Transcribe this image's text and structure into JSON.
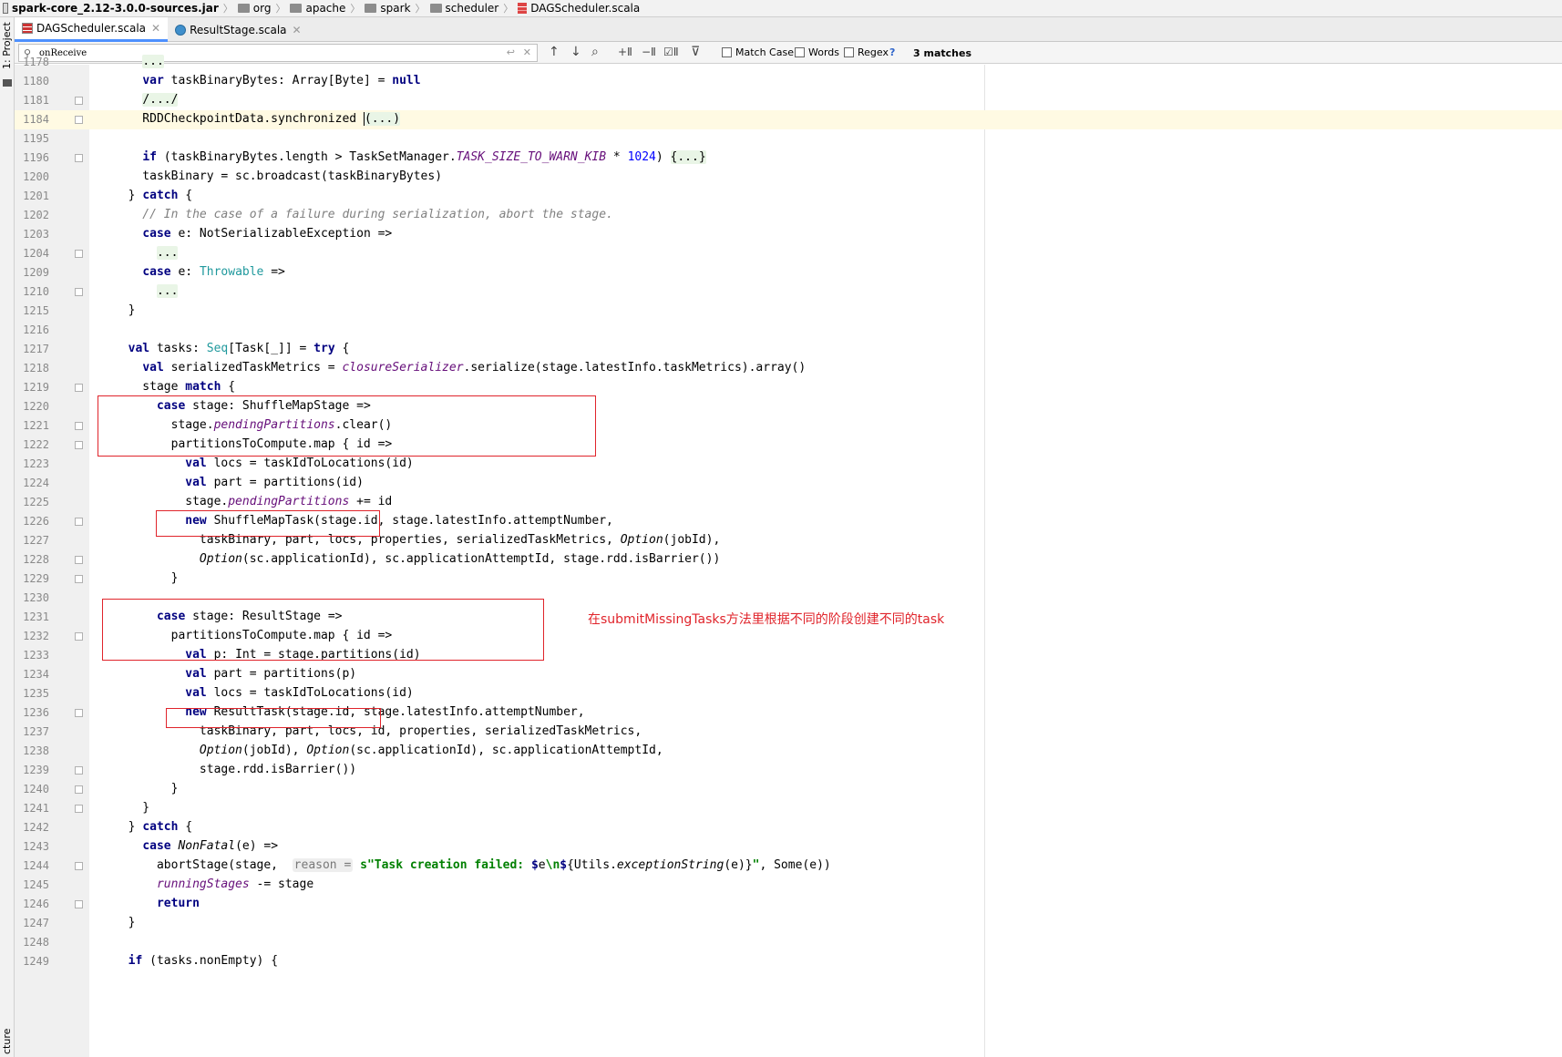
{
  "breadcrumb": [
    {
      "label": "spark-core_2.12-3.0.0-sources.jar",
      "icon": "jar-icon"
    },
    {
      "label": "org",
      "icon": "folder-icon"
    },
    {
      "label": "apache",
      "icon": "folder-icon"
    },
    {
      "label": "spark",
      "icon": "folder-icon"
    },
    {
      "label": "scheduler",
      "icon": "folder-icon"
    },
    {
      "label": "DAGScheduler.scala",
      "icon": "scala-file-icon"
    }
  ],
  "left_strip": {
    "project": "1: Project",
    "structure": "cture"
  },
  "tabs": [
    {
      "label": "DAGScheduler.scala",
      "active": true
    },
    {
      "label": "ResultStage.scala",
      "active": false
    }
  ],
  "search": {
    "query": "onReceive",
    "match_case": "Match Case",
    "words": "Words",
    "regex": "Regex",
    "help": "?",
    "matches": "3 matches"
  },
  "annotation": "在submitMissingTasks方法里根据不同的阶段创建不同的task",
  "lines": [
    {
      "n": "1178",
      "code": "    ..."
    },
    {
      "n": "1180",
      "code": "    var taskBinaryBytes: Array[Byte] = null"
    },
    {
      "n": "1181",
      "code": "    /.../"
    },
    {
      "n": "1184",
      "code": "    RDDCheckpointData.synchronized (...)"
    },
    {
      "n": "1195",
      "code": ""
    },
    {
      "n": "1196",
      "code": "    if (taskBinaryBytes.length > TaskSetManager.TASK_SIZE_TO_WARN_KIB * 1024) {...}"
    },
    {
      "n": "1200",
      "code": "    taskBinary = sc.broadcast(taskBinaryBytes)"
    },
    {
      "n": "1201",
      "code": "  } catch {"
    },
    {
      "n": "1202",
      "code": "    // In the case of a failure during serialization, abort the stage."
    },
    {
      "n": "1203",
      "code": "    case e: NotSerializableException =>"
    },
    {
      "n": "1204",
      "code": "      ..."
    },
    {
      "n": "1209",
      "code": "    case e: Throwable =>"
    },
    {
      "n": "1210",
      "code": "      ..."
    },
    {
      "n": "1215",
      "code": "  }"
    },
    {
      "n": "1216",
      "code": ""
    },
    {
      "n": "1217",
      "code": "  val tasks: Seq[Task[_]] = try {"
    },
    {
      "n": "1218",
      "code": "    val serializedTaskMetrics = closureSerializer.serialize(stage.latestInfo.taskMetrics).array()"
    },
    {
      "n": "1219",
      "code": "    stage match {"
    },
    {
      "n": "1220",
      "code": "      case stage: ShuffleMapStage =>"
    },
    {
      "n": "1221",
      "code": "        stage.pendingPartitions.clear()"
    },
    {
      "n": "1222",
      "code": "        partitionsToCompute.map { id =>"
    },
    {
      "n": "1223",
      "code": "          val locs = taskIdToLocations(id)"
    },
    {
      "n": "1224",
      "code": "          val part = partitions(id)"
    },
    {
      "n": "1225",
      "code": "          stage.pendingPartitions += id"
    },
    {
      "n": "1226",
      "code": "          new ShuffleMapTask(stage.id, stage.latestInfo.attemptNumber,"
    },
    {
      "n": "1227",
      "code": "            taskBinary, part, locs, properties, serializedTaskMetrics, Option(jobId),"
    },
    {
      "n": "1228",
      "code": "            Option(sc.applicationId), sc.applicationAttemptId, stage.rdd.isBarrier())"
    },
    {
      "n": "1229",
      "code": "        }"
    },
    {
      "n": "1230",
      "code": ""
    },
    {
      "n": "1231",
      "code": "      case stage: ResultStage =>"
    },
    {
      "n": "1232",
      "code": "        partitionsToCompute.map { id =>"
    },
    {
      "n": "1233",
      "code": "          val p: Int = stage.partitions(id)"
    },
    {
      "n": "1234",
      "code": "          val part = partitions(p)"
    },
    {
      "n": "1235",
      "code": "          val locs = taskIdToLocations(id)"
    },
    {
      "n": "1236",
      "code": "          new ResultTask(stage.id, stage.latestInfo.attemptNumber,"
    },
    {
      "n": "1237",
      "code": "            taskBinary, part, locs, id, properties, serializedTaskMetrics,"
    },
    {
      "n": "1238",
      "code": "            Option(jobId), Option(sc.applicationId), sc.applicationAttemptId,"
    },
    {
      "n": "1239",
      "code": "            stage.rdd.isBarrier())"
    },
    {
      "n": "1240",
      "code": "        }"
    },
    {
      "n": "1241",
      "code": "    }"
    },
    {
      "n": "1242",
      "code": "  } catch {"
    },
    {
      "n": "1243",
      "code": "    case NonFatal(e) =>"
    },
    {
      "n": "1244",
      "code": "      abortStage(stage,  reason = s\"Task creation failed: $e\\n${Utils.exceptionString(e)}\", Some(e))"
    },
    {
      "n": "1245",
      "code": "      runningStages -= stage"
    },
    {
      "n": "1246",
      "code": "      return"
    },
    {
      "n": "1247",
      "code": "  }"
    },
    {
      "n": "1248",
      "code": ""
    },
    {
      "n": "1249",
      "code": "  if (tasks.nonEmpty) {"
    }
  ],
  "colors": {
    "keyword": "#000080",
    "type": "#20999d",
    "purple": "#660e7a",
    "comment": "#808080",
    "number": "#0000ff",
    "string": "#008000",
    "annotation": "#e0242b",
    "current_line": "#fffae3"
  }
}
